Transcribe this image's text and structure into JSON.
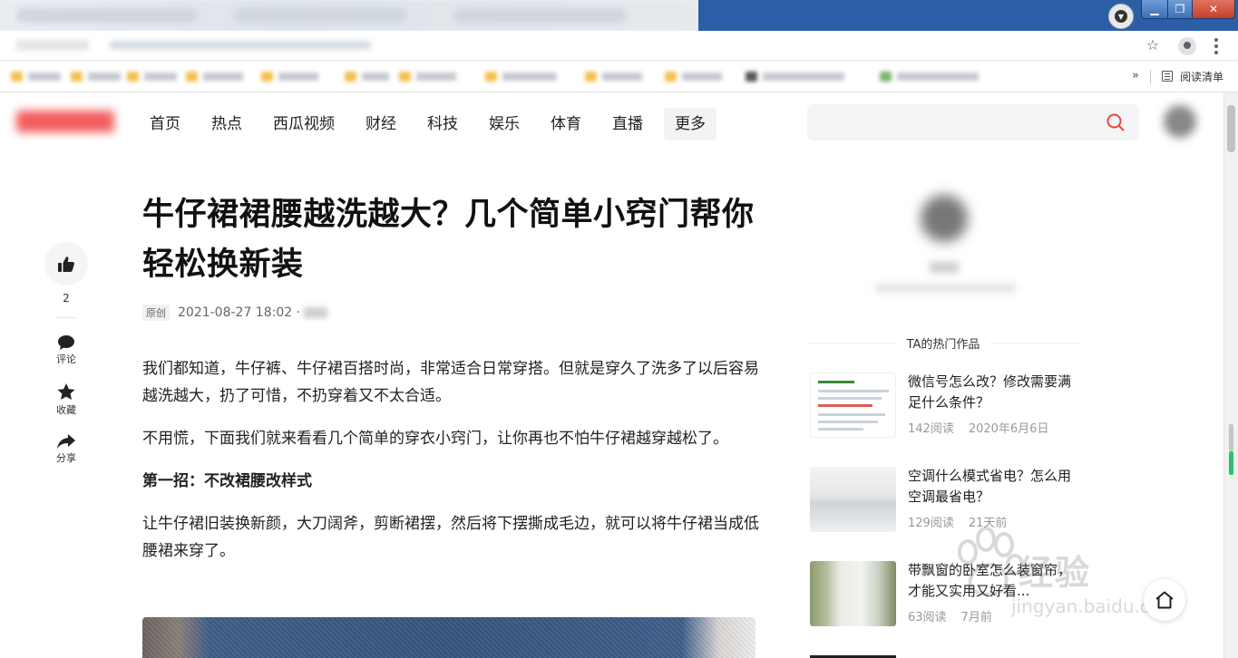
{
  "browser": {
    "bookmarks_more": "»",
    "reading_list_label": "阅读清单",
    "star_icon": "☆"
  },
  "site_nav": {
    "items": [
      "首页",
      "热点",
      "西瓜视频",
      "财经",
      "科技",
      "娱乐",
      "体育",
      "直播"
    ],
    "more_label": "更多"
  },
  "article": {
    "title": "牛仔裙裙腰越洗越大？几个简单小窍门帮你轻松换新装",
    "original_tag": "原创",
    "datetime": "2021-08-27 18:02 ·",
    "paragraphs": {
      "p1": "我们都知道，牛仔裤、牛仔裙百搭时尚，非常适合日常穿搭。但就是穿久了洗多了以后容易越洗越大，扔了可惜，不扔穿着又不太合适。",
      "p2": "不用慌，下面我们就来看看几个简单的穿衣小窍门，让你再也不怕牛仔裙越穿越松了。",
      "subhead1": "第一招：不改裙腰改样式",
      "p3": "让牛仔裙旧装换新颜，大刀阔斧，剪断裙摆，然后将下摆撕成毛边，就可以将牛仔裙当成低腰裙来穿了。"
    }
  },
  "actions": {
    "like_count": "2",
    "comment_label": "评论",
    "favorite_label": "收藏",
    "share_label": "分享"
  },
  "sidebar": {
    "hot_works_heading": "TA的热门作品",
    "hot_works": [
      {
        "title": "微信号怎么改？修改需要满足什么条件？",
        "reads": "142阅读",
        "date": "2020年6月6日"
      },
      {
        "title": "空调什么模式省电？怎么用空调最省电？",
        "reads": "129阅读",
        "date": "21天前"
      },
      {
        "title": "带飘窗的卧室怎么装窗帘，才能又实用又好看...",
        "reads": "63阅读",
        "date": "7月前"
      }
    ]
  },
  "watermark": {
    "brand": "经验",
    "url": "jingyan.baidu.com"
  },
  "colors": {
    "accent_red": "#f04142",
    "titlebar_blue": "#2b5ea7",
    "scroll_green": "#2ec266"
  }
}
